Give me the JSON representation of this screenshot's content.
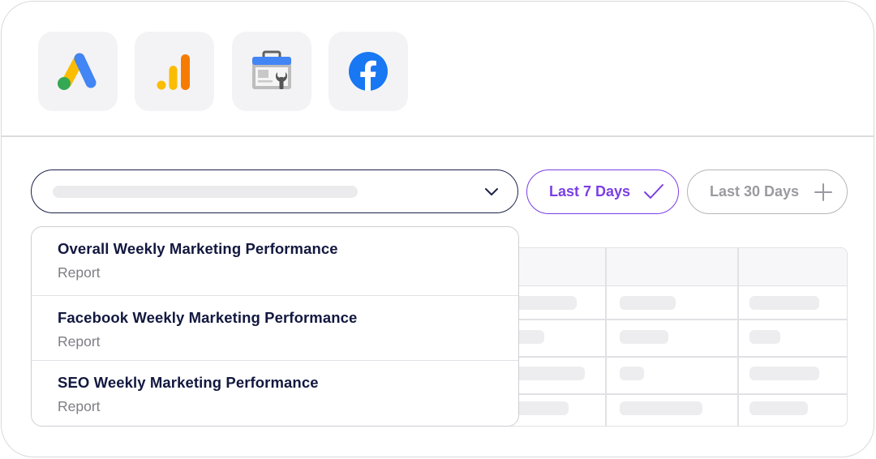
{
  "integrations": [
    {
      "name": "google-ads-icon"
    },
    {
      "name": "google-analytics-icon"
    },
    {
      "name": "google-search-console-icon"
    },
    {
      "name": "facebook-icon"
    }
  ],
  "filters": {
    "last7": {
      "label": "Last 7 Days",
      "state": "selected",
      "icon": "check-icon",
      "color": "#7b3fe4"
    },
    "last30": {
      "label": "Last 30 Days",
      "state": "unselected",
      "icon": "plus-icon"
    }
  },
  "report_select": {
    "value": "",
    "icon": "chevron-down-icon",
    "open": true
  },
  "dropdown": {
    "options": [
      {
        "title": "Overall Weekly Marketing Performance",
        "subtitle": "Report"
      },
      {
        "title": "Facebook Weekly Marketing Performance",
        "subtitle": "Report"
      },
      {
        "title": "SEO Weekly Marketing Performance",
        "subtitle": "Report"
      }
    ]
  },
  "colors": {
    "accent": "#7b3fe4",
    "navy_text": "#12183f",
    "muted_text": "#7d7d85",
    "border": "#d9d9dc"
  }
}
